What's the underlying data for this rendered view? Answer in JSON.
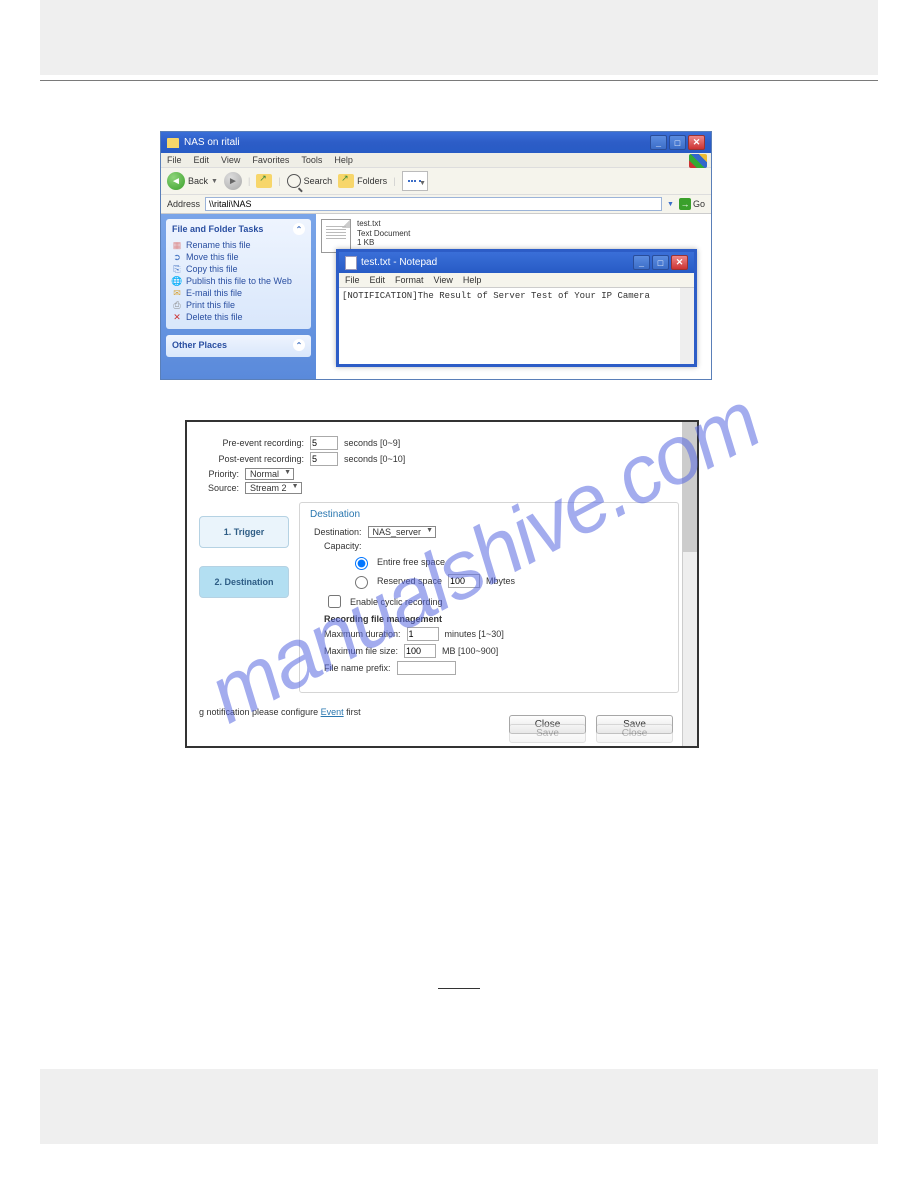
{
  "watermark": "manualshive.com",
  "explorer": {
    "title": "NAS on ritali",
    "menus": [
      "File",
      "Edit",
      "View",
      "Favorites",
      "Tools",
      "Help"
    ],
    "back": "Back",
    "search": "Search",
    "folders": "Folders",
    "address_label": "Address",
    "address_value": "\\\\ritali\\NAS",
    "go": "Go",
    "panel_tasks_title": "File and Folder Tasks",
    "tasks": {
      "rename": "Rename this file",
      "move": "Move this file",
      "copy": "Copy this file",
      "publish": "Publish this file to the Web",
      "email": "E-mail this file",
      "print": "Print this file",
      "delete": "Delete this file"
    },
    "panel_other_title": "Other Places",
    "file": {
      "name": "test.txt",
      "type": "Text Document",
      "size": "1 KB"
    }
  },
  "notepad": {
    "title": "test.txt - Notepad",
    "menus": [
      "File",
      "Edit",
      "Format",
      "View",
      "Help"
    ],
    "content": "[NOTIFICATION]The Result of Server Test of Your IP Camera"
  },
  "settings": {
    "pre_label": "Pre-event recording:",
    "pre_value": "5",
    "pre_units": "seconds [0~9]",
    "post_label": "Post-event recording:",
    "post_value": "5",
    "post_units": "seconds [0~10]",
    "priority_label": "Priority:",
    "priority_value": "Normal",
    "source_label": "Source:",
    "source_value": "Stream 2",
    "step1": "1. Trigger",
    "step2": "2. Destination",
    "dest_header": "Destination",
    "dest_label": "Destination:",
    "dest_value": "NAS_server",
    "capacity_label": "Capacity:",
    "opt_entire": "Entire free space",
    "opt_reserved": "Reserved space",
    "reserved_value": "100",
    "reserved_unit": "Mbytes",
    "cyclic": "Enable cyclic recording",
    "mgmt_header": "Recording file management",
    "max_dur_label": "Maximum duration:",
    "max_dur_value": "1",
    "max_dur_unit": "minutes [1~30]",
    "max_size_label": "Maximum file size:",
    "max_size_value": "100",
    "max_size_unit": "MB [100~900]",
    "prefix_label": "File name prefix:",
    "note_pre": "g notification please configure ",
    "note_link": "Event",
    "note_post": " first",
    "close": "Close",
    "save": "Save"
  }
}
